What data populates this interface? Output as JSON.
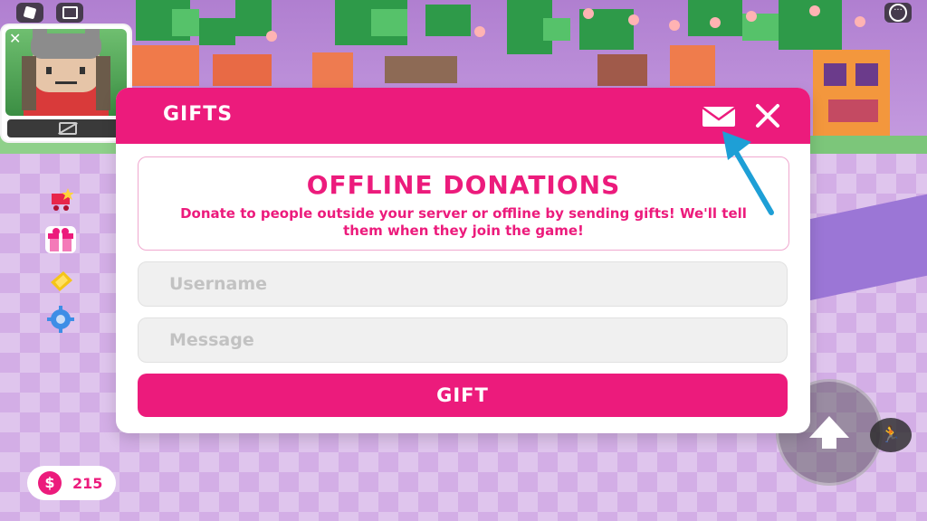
{
  "modal": {
    "title": "GIFTS",
    "mail_icon": "mail-icon",
    "close_icon": "close-icon",
    "info_heading": "OFFLINE DONATIONS",
    "info_text": "Donate to people outside your server or offline by sending gifts! We'll tell them when they join the game!",
    "username_placeholder": "Username",
    "message_placeholder": "Message",
    "gift_button": "GIFT"
  },
  "hud": {
    "currency_icon": "dollar-icon",
    "currency_symbol": "$",
    "currency_amount": "215",
    "side_icons": [
      "shop-cart-icon",
      "gift-box-icon",
      "ticket-icon",
      "settings-gear-icon"
    ]
  },
  "colors": {
    "brand_pink": "#ec1b7c",
    "annotation_arrow": "#1e9fd6"
  }
}
